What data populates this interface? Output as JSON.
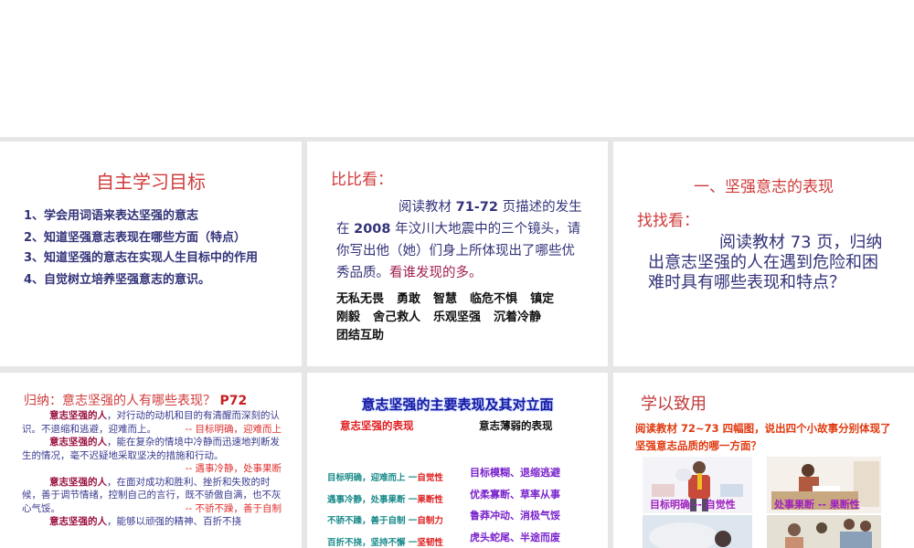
{
  "slides": [
    {
      "title": "自主学习目标",
      "items": [
        "1、学会用词语来表达坚强的意志",
        "2、知道坚强意志表现在哪些方面（特点）",
        "3、知道坚强的意志在实现人生目标中的作用",
        "4、自觉树立培养坚强意志的意识。"
      ]
    },
    {
      "title": "比比看：",
      "para_a": "阅读教材 ",
      "para_b": "71-72",
      "para_c": " 页描述的发生在 ",
      "para_d": "2008",
      "para_e": " 年汶川大地震中的三个镜头，请你写出他（她）们身上所体现出了哪些优秀品质。",
      "para_f": "看谁发现的多。",
      "tags": [
        "无私无畏",
        "勇敢",
        "智慧",
        "临危不惧",
        "镇定",
        "刚毅",
        "舍己救人",
        "乐观坚强",
        "沉着冷静",
        "团结互助"
      ]
    },
    {
      "heading": "一、坚强意志的表现",
      "find": "找找看：",
      "para": "阅读教材 73 页，归纳出意志坚强的人在遇到危险和困难时具有哪些表现和特点？"
    },
    {
      "title": "归纳：意志坚强的人有哪些表现？",
      "page": "P72",
      "key": "意志坚强的人",
      "paras": [
        {
          "text": "，对行动的动机和目的有清醒而深刻的认识。不退缩和逃避，迎难而上。",
          "tag": "-- 目标明确，迎难而上"
        },
        {
          "text": "，能在复杂的情境中冷静而迅速地判断发生的情况，毫不迟疑地采取坚决的措施和行动。",
          "tag": "-- 遇事冷静，处事果断"
        },
        {
          "text": "，在面对成功和胜利、挫折和失败的时候，善于调节情绪，控制自己的言行，既不骄傲自满，也不灰心气馁。",
          "tag": "-- 不骄不躁，善于自制"
        },
        {
          "text": "，能够以顽强的精神、百折不挠",
          "tag": ""
        }
      ]
    },
    {
      "title": "意志坚强的主要表现及其对立面",
      "left_head": "意志坚强的表现",
      "right_head": "意志薄弱的表现",
      "left": [
        {
          "a": "目标明确，迎难而上 一",
          "b": "自觉性"
        },
        {
          "a": "遇事冷静，处事果断 一",
          "b": "果断性"
        },
        {
          "a": "不骄不躁，善于自制 一",
          "b": "自制力"
        },
        {
          "a": "百折不挠，坚持不懈 一",
          "b": "坚韧性"
        }
      ],
      "right": [
        "目标模糊、退缩逃避",
        "优柔寡断、草率从事",
        "鲁莽冲动、消极气馁",
        "虎头蛇尾、半途而废"
      ]
    },
    {
      "title": "学以致用",
      "question": "阅读教材 72~73 四幅图，说出四个小故事分别体现了坚强意志品质的哪一方面？",
      "captions": [
        "目标明确 -- 自觉性",
        "处事果断 -- 果断性"
      ]
    }
  ]
}
